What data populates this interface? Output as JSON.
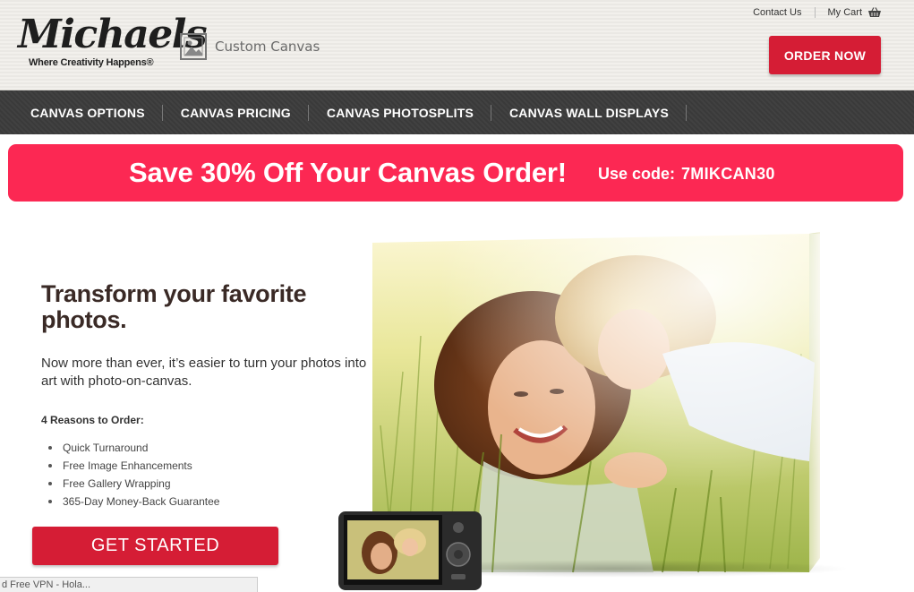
{
  "brand": {
    "logo_text": "Michaels",
    "tagline": "Where Creativity Happens®",
    "product_name": "Custom Canvas"
  },
  "utility": {
    "contact": "Contact Us",
    "cart": "My Cart"
  },
  "header": {
    "order_button": "ORDER NOW"
  },
  "nav": {
    "items": [
      {
        "label": "CANVAS OPTIONS"
      },
      {
        "label": "CANVAS PRICING"
      },
      {
        "label": "CANVAS PHOTOSPLITS"
      },
      {
        "label": "CANVAS WALL DISPLAYS"
      }
    ]
  },
  "promo": {
    "headline": "Save 30% Off Your Canvas Order!",
    "code_label": "Use code:",
    "code": "7MIKCAN30"
  },
  "hero": {
    "headline": "Transform your favorite photos.",
    "intro": "Now more than ever, it’s easier to turn your photos into art with photo-on-canvas.",
    "reasons_title": "4 Reasons to Order:",
    "reasons": [
      "Quick Turnaround",
      "Free Image Enhancements",
      "Free Gallery Wrapping",
      "365-Day Money-Back Guarantee"
    ],
    "cta": "GET STARTED"
  },
  "statusbar": {
    "text": "d Free VPN - Hola..."
  },
  "colors": {
    "accent_red": "#d51d35",
    "promo_pink": "#fc2853",
    "nav_dark": "#3a3a3a",
    "header_bg": "#efede8"
  },
  "icons": {
    "product": "picture-frame-icon",
    "cart": "shopping-basket-icon"
  }
}
